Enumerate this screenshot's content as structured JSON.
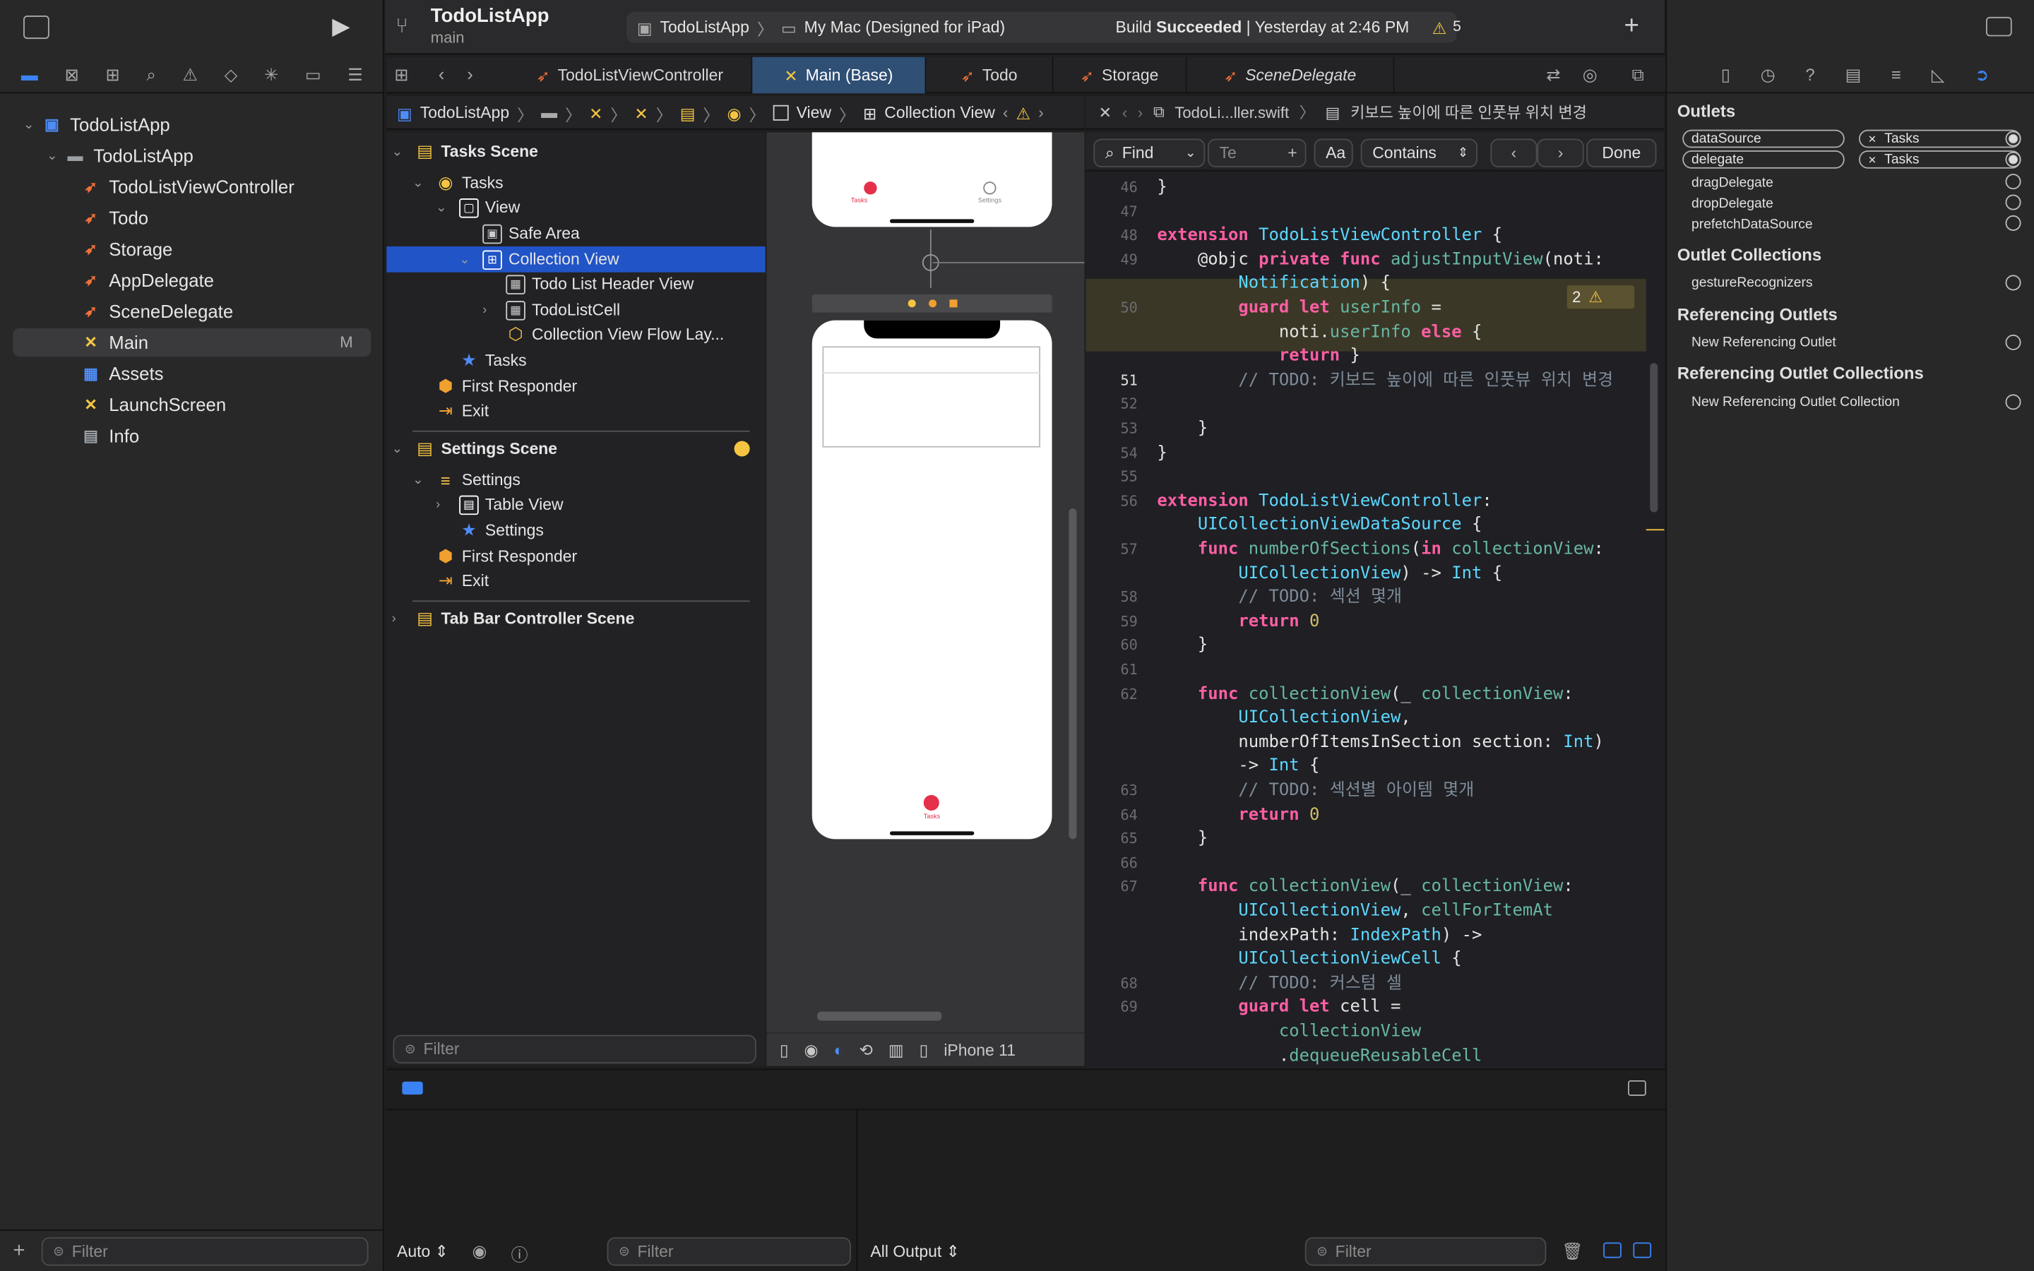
{
  "toolbar": {
    "project_name": "TodoListApp",
    "branch": "main",
    "scheme": "TodoListApp",
    "destination": "My Mac (Designed for iPad)",
    "build_prefix": "Build ",
    "build_status": "Succeeded",
    "build_time": "| Yesterday at 2:46 PM",
    "warning_count": "5",
    "add_label": "+"
  },
  "navigator": {
    "items": [
      {
        "label": "TodoListApp",
        "kind": "project"
      },
      {
        "label": "TodoListApp",
        "kind": "folder"
      },
      {
        "label": "TodoListViewController",
        "kind": "swift"
      },
      {
        "label": "Todo",
        "kind": "swift"
      },
      {
        "label": "Storage",
        "kind": "swift"
      },
      {
        "label": "AppDelegate",
        "kind": "swift"
      },
      {
        "label": "SceneDelegate",
        "kind": "swift"
      },
      {
        "label": "Main",
        "kind": "storyboard",
        "badge": "M"
      },
      {
        "label": "Assets",
        "kind": "assets"
      },
      {
        "label": "LaunchScreen",
        "kind": "storyboard"
      },
      {
        "label": "Info",
        "kind": "plist"
      }
    ],
    "filter_placeholder": "Filter"
  },
  "tabs": [
    {
      "label": "TodoListViewController"
    },
    {
      "label": "Main (Base)"
    },
    {
      "label": "Todo"
    },
    {
      "label": "Storage"
    },
    {
      "label": "SceneDelegate"
    }
  ],
  "ib_jumpbar": {
    "project": "TodoListApp",
    "view": "View",
    "collection_view": "Collection View"
  },
  "code_jumpbar": {
    "file": "TodoLi...ller.swift",
    "mark": "키보드 높이에 따른 인풋뷰 위치 변경"
  },
  "find": {
    "mode": "Find",
    "placeholder": "Te",
    "case_label": "Aa",
    "match": "Contains",
    "done": "Done"
  },
  "outline": {
    "rows": [
      {
        "label": "Tasks Scene",
        "bold": true
      },
      {
        "label": "Tasks"
      },
      {
        "label": "View"
      },
      {
        "label": "Safe Area"
      },
      {
        "label": "Collection View"
      },
      {
        "label": "Todo List Header View"
      },
      {
        "label": "TodoListCell"
      },
      {
        "label": "Collection View Flow Lay..."
      },
      {
        "label": "Tasks"
      },
      {
        "label": "First Responder"
      },
      {
        "label": "Exit"
      },
      {
        "label": "Settings Scene",
        "bold": true
      },
      {
        "label": "Settings"
      },
      {
        "label": "Table View"
      },
      {
        "label": "Settings"
      },
      {
        "label": "First Responder"
      },
      {
        "label": "Exit"
      },
      {
        "label": "Tab Bar Controller Scene",
        "bold": true
      }
    ],
    "filter_placeholder": "Filter"
  },
  "canvas": {
    "device": "iPhone 11",
    "tab_tasks": "Tasks",
    "tab_settings": "Settings"
  },
  "code": {
    "warning_badge": "2",
    "lines": [
      {
        "n": "46",
        "t": "}"
      },
      {
        "n": "47",
        "t": ""
      },
      {
        "n": "48",
        "t": "extension TodoListViewController {"
      },
      {
        "n": "49",
        "t": "    @objc private func adjustInputView(noti:"
      },
      {
        "n": "",
        "t": "        Notification) {"
      },
      {
        "n": "50",
        "t": "        guard let userInfo ="
      },
      {
        "n": "",
        "t": "            noti.userInfo else {"
      },
      {
        "n": "",
        "t": "            return }"
      },
      {
        "n": "51",
        "t": "        // TODO: 키보드 높이에 따른 인풋뷰 위치 변경"
      },
      {
        "n": "52",
        "t": "        "
      },
      {
        "n": "53",
        "t": "    }"
      },
      {
        "n": "54",
        "t": "}"
      },
      {
        "n": "55",
        "t": ""
      },
      {
        "n": "56",
        "t": "extension TodoListViewController:"
      },
      {
        "n": "",
        "t": "    UICollectionViewDataSource {"
      },
      {
        "n": "57",
        "t": "    func numberOfSections(in collectionView:"
      },
      {
        "n": "",
        "t": "        UICollectionView) -> Int {"
      },
      {
        "n": "58",
        "t": "        // TODO: 섹션 몇개"
      },
      {
        "n": "59",
        "t": "        return 0"
      },
      {
        "n": "60",
        "t": "    }"
      },
      {
        "n": "61",
        "t": "    "
      },
      {
        "n": "62",
        "t": "    func collectionView(_ collectionView:"
      },
      {
        "n": "",
        "t": "        UICollectionView,"
      },
      {
        "n": "",
        "t": "        numberOfItemsInSection section: Int)"
      },
      {
        "n": "",
        "t": "        -> Int {"
      },
      {
        "n": "63",
        "t": "        // TODO: 섹션별 아이템 몇개"
      },
      {
        "n": "64",
        "t": "        return 0"
      },
      {
        "n": "65",
        "t": "    }"
      },
      {
        "n": "66",
        "t": "    "
      },
      {
        "n": "67",
        "t": "    func collectionView(_ collectionView:"
      },
      {
        "n": "",
        "t": "        UICollectionView, cellForItemAt"
      },
      {
        "n": "",
        "t": "        indexPath: IndexPath) ->"
      },
      {
        "n": "",
        "t": "        UICollectionViewCell {"
      },
      {
        "n": "68",
        "t": "        // TODO: 커스텀 셀"
      },
      {
        "n": "69",
        "t": "        guard let cell ="
      },
      {
        "n": "",
        "t": "            collectionView"
      },
      {
        "n": "",
        "t": "            .dequeueReusableCell"
      }
    ]
  },
  "inspector": {
    "outlets_title": "Outlets",
    "outlets": [
      {
        "name": "dataSource",
        "target": "Tasks",
        "connected": true
      },
      {
        "name": "delegate",
        "target": "Tasks",
        "connected": true
      },
      {
        "name": "dragDelegate"
      },
      {
        "name": "dropDelegate"
      },
      {
        "name": "prefetchDataSource"
      }
    ],
    "collections_title": "Outlet Collections",
    "collections": [
      "gestureRecognizers"
    ],
    "ref_title": "Referencing Outlets",
    "ref_items": [
      "New Referencing Outlet"
    ],
    "ref_coll_title": "Referencing Outlet Collections",
    "ref_coll_items": [
      "New Referencing Outlet Collection"
    ]
  },
  "debug": {
    "auto_label": "Auto",
    "filter_placeholder": "Filter",
    "output_label": "All Output",
    "filter2_placeholder": "Filter"
  },
  "colors": {
    "accent": "#2154c6",
    "swift": "#f0713a",
    "keyword": "#fc5fa3",
    "type": "#5dd8ff",
    "warning": "#f5c542"
  }
}
